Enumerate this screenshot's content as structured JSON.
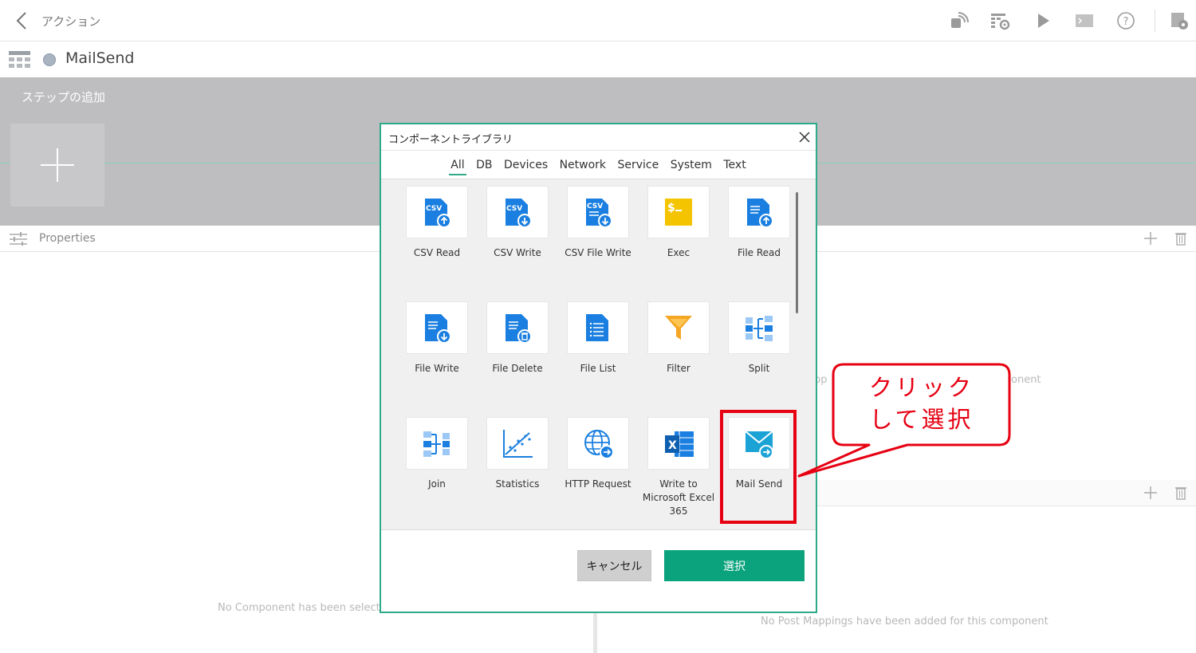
{
  "topbar": {
    "title": "アクション",
    "icons": [
      "broadcast-icon",
      "settings-table-icon",
      "play-icon",
      "console-icon",
      "help-icon",
      "export-settings-icon"
    ]
  },
  "flow": {
    "name": "MailSend",
    "status_color": "#a9b4c2"
  },
  "steps": {
    "title": "ステップの追加"
  },
  "properties": {
    "label": "Properties"
  },
  "background_text": {
    "left_empty": "No Component has been selecte",
    "right_empty": "No Post Mappings have been added for this component",
    "pp_fragment": "pp",
    "onent_fragment": "onent"
  },
  "dialog": {
    "title": "コンポーネントライブラリ",
    "tabs": [
      {
        "label": "All",
        "active": true
      },
      {
        "label": "DB",
        "active": false
      },
      {
        "label": "Devices",
        "active": false
      },
      {
        "label": "Network",
        "active": false
      },
      {
        "label": "Service",
        "active": false
      },
      {
        "label": "System",
        "active": false
      },
      {
        "label": "Text",
        "active": false
      }
    ],
    "components": [
      {
        "label": "CSV Read",
        "icon": "csv-read-icon"
      },
      {
        "label": "CSV Write",
        "icon": "csv-write-icon"
      },
      {
        "label": "CSV File Write",
        "icon": "csv-file-write-icon"
      },
      {
        "label": "Exec",
        "icon": "exec-terminal-icon"
      },
      {
        "label": "File Read",
        "icon": "file-read-icon"
      },
      {
        "label": "File Write",
        "icon": "file-write-icon"
      },
      {
        "label": "File Delete",
        "icon": "file-delete-icon"
      },
      {
        "label": "File List",
        "icon": "file-list-icon"
      },
      {
        "label": "Filter",
        "icon": "filter-funnel-icon"
      },
      {
        "label": "Split",
        "icon": "split-icon"
      },
      {
        "label": "Join",
        "icon": "join-icon"
      },
      {
        "label": "Statistics",
        "icon": "statistics-chart-icon"
      },
      {
        "label": "HTTP Request",
        "icon": "http-globe-icon"
      },
      {
        "label": "Write to Microsoft Excel 365",
        "icon": "excel-icon"
      },
      {
        "label": "Mail Send",
        "icon": "mail-send-icon"
      }
    ],
    "cancel_label": "キャンセル",
    "select_label": "選択"
  },
  "annotation": {
    "callout_line1": "クリック",
    "callout_line2": "して選択",
    "color": "#e60012"
  },
  "colors": {
    "accent": "#2eaa8a",
    "primary_button": "#0aa37d",
    "icon_blue": "#1a7fe0",
    "icon_yellow": "#f5c400"
  }
}
